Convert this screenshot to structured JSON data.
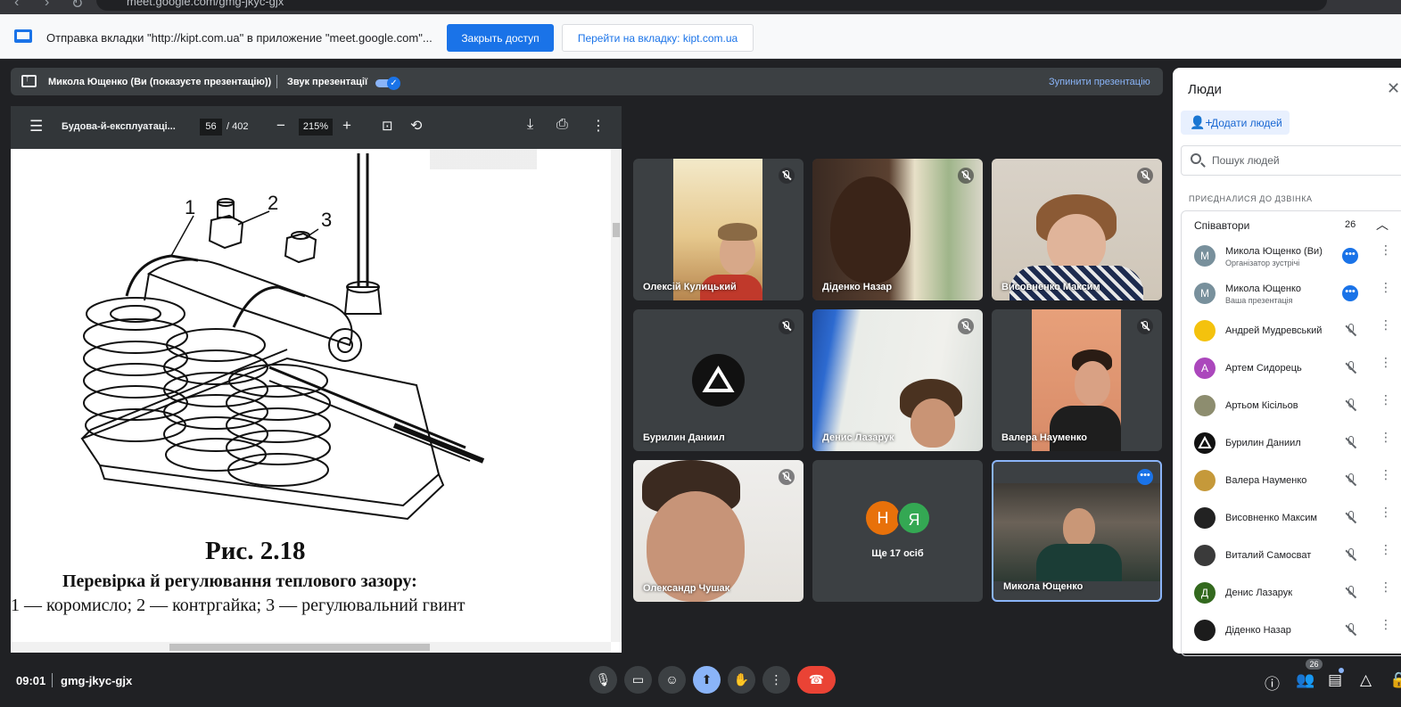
{
  "browser": {
    "url": "meet.google.com/gmg-jkyc-gjx"
  },
  "share_bar": {
    "message": "Отправка вкладки \"http://kipt.com.ua\" в приложение \"meet.google.com\"...",
    "stop_button": "Закрыть доступ",
    "goto_button": "Перейти на вкладку: kipt.com.ua"
  },
  "presenting": {
    "presenter": "Микола Ющенко (Ви (показуєте презентацію))",
    "sound_label": "Звук презентації",
    "sound_on": true,
    "stop_label": "Зупинити презентацію"
  },
  "pdf": {
    "title": "Будова-й-експлуатаці...",
    "page": "56",
    "page_total": "/ 402",
    "zoom": "215%",
    "figure": {
      "callouts": [
        "1",
        "2",
        "3"
      ],
      "number": "Рис. 2.18",
      "title": "Перевірка й регулювання теплового зазору:",
      "legend": "1 — коромисло; 2 — контргайка; 3 — регулювальний гвинт"
    }
  },
  "tiles": [
    {
      "name": "Олексій Кулицький",
      "muted": true
    },
    {
      "name": "Діденко Назар",
      "muted": true
    },
    {
      "name": "Висовненко Максим",
      "muted": true
    },
    {
      "name": "Бурилин Даниил",
      "muted": true
    },
    {
      "name": "Денис Лазарук",
      "muted": true
    },
    {
      "name": "Валера Науменко",
      "muted": true
    },
    {
      "name": "Олександр Чушак",
      "muted": true
    },
    {
      "name": "Ще 17 осіб",
      "avatars": [
        "Н",
        "Я"
      ]
    },
    {
      "name": "Микола Ющенко",
      "active": true
    }
  ],
  "people_panel": {
    "title": "Люди",
    "add_people": "Додати людей",
    "search_placeholder": "Пошук людей",
    "joined_label": "ПРИЄДНАЛИСЯ ДО ДЗВІНКА",
    "group_label": "Співавтори",
    "group_count": "26",
    "participants": [
      {
        "name": "Микола Ющенко (Ви)",
        "role": "Організатор зустрічі",
        "initial": "М",
        "color": "#78909c"
      },
      {
        "name": "Микола Ющенко",
        "role": "Ваша презентація",
        "initial": "М",
        "color": "#78909c"
      },
      {
        "name": "Андрей Мудревський",
        "initial": "",
        "color": "#f4c20d"
      },
      {
        "name": "Артем Сидорець",
        "initial": "А",
        "color": "#ab47bc"
      },
      {
        "name": "Артьом Кісільов",
        "initial": "",
        "color": "#8d8d6f"
      },
      {
        "name": "Бурилин Даниил",
        "initial": "",
        "color": "#111111"
      },
      {
        "name": "Валера Науменко",
        "initial": "",
        "color": "#c5993a"
      },
      {
        "name": "Висовненко Максим",
        "initial": "",
        "color": "#222222"
      },
      {
        "name": "Виталий Самосват",
        "initial": "",
        "color": "#3a3a3a"
      },
      {
        "name": "Денис Лазарук",
        "initial": "Д",
        "color": "#33691e"
      },
      {
        "name": "Діденко Назар",
        "initial": "",
        "color": "#1c1c1c"
      }
    ]
  },
  "bottom_bar": {
    "time": "09:01",
    "meeting_code": "gmg-jkyc-gjx",
    "people_count": "26"
  }
}
